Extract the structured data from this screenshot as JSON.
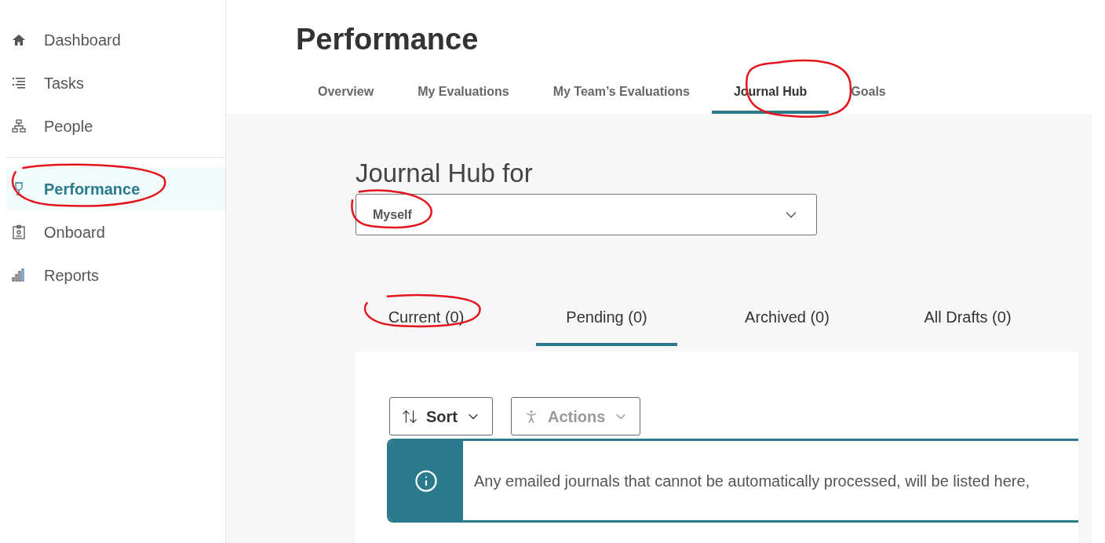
{
  "sidebar": {
    "groups": [
      {
        "items": [
          {
            "label": "Dashboard",
            "selected": false
          },
          {
            "label": "Tasks",
            "selected": false
          },
          {
            "label": "People",
            "selected": false
          }
        ]
      },
      {
        "items": [
          {
            "label": "Performance",
            "selected": true
          },
          {
            "label": "Onboard",
            "selected": false
          },
          {
            "label": "Reports",
            "selected": false
          }
        ]
      }
    ]
  },
  "page": {
    "title": "Performance"
  },
  "tabs": [
    {
      "label": "Overview",
      "selected": false
    },
    {
      "label": "My Evaluations",
      "selected": false
    },
    {
      "label": "My Team’s Evaluations",
      "selected": false
    },
    {
      "label": "Journal Hub",
      "selected": true
    },
    {
      "label": "Goals",
      "selected": false
    }
  ],
  "journal_hub": {
    "title": "Journal Hub for",
    "select": {
      "value": "Myself"
    },
    "subtabs": [
      {
        "label": "Current (0)",
        "selected": false
      },
      {
        "label": "Pending (0)",
        "selected": true
      },
      {
        "label": "Archived (0)",
        "selected": false
      },
      {
        "label": "All Drafts (0)",
        "selected": false
      }
    ],
    "toolbar": [
      {
        "label": "Sort",
        "disabled": false
      },
      {
        "label": "Actions",
        "disabled": true
      }
    ],
    "notice": "Any emailed journals that cannot be automatically processed, will be listed here,"
  }
}
